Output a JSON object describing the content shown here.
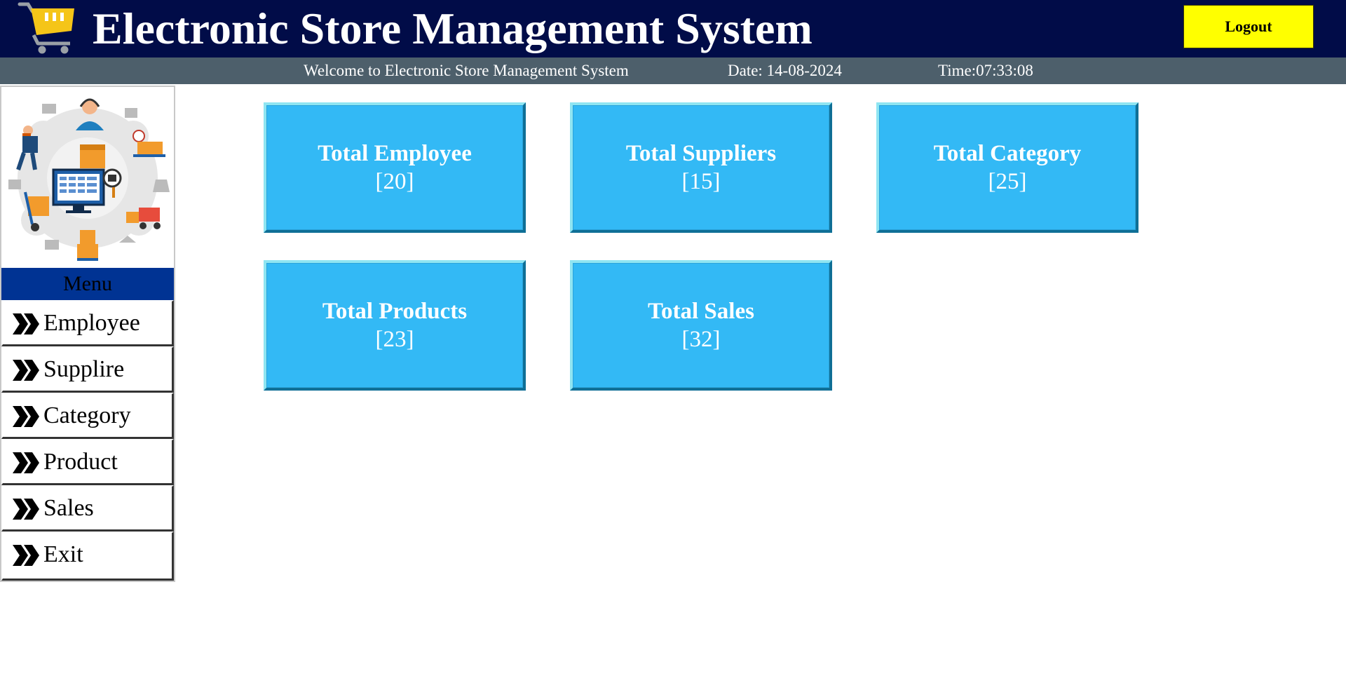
{
  "header": {
    "title": "Electronic Store Management System",
    "logout_label": "Logout",
    "logo_icon": "shopping-cart-icon"
  },
  "status_bar": {
    "welcome": "Welcome to Electronic Store Management System",
    "date": "Date: 14-08-2024",
    "time": "Time:07:33:08"
  },
  "sidebar": {
    "menu_title": "Menu",
    "items": [
      {
        "label": "Employee",
        "icon": "double-chevron-right-icon"
      },
      {
        "label": "Supplire",
        "icon": "double-chevron-right-icon"
      },
      {
        "label": "Category",
        "icon": "double-chevron-right-icon"
      },
      {
        "label": "Product",
        "icon": "double-chevron-right-icon"
      },
      {
        "label": "Sales",
        "icon": "double-chevron-right-icon"
      },
      {
        "label": "Exit",
        "icon": "double-chevron-right-icon"
      }
    ]
  },
  "dashboard": {
    "tiles": [
      {
        "title": "Total Employee",
        "count": "[20]"
      },
      {
        "title": "Total Suppliers",
        "count": "[15]"
      },
      {
        "title": "Total Category",
        "count": "[25]"
      },
      {
        "title": "Total Products",
        "count": "[23]"
      },
      {
        "title": "Total Sales",
        "count": "[32]"
      }
    ]
  },
  "colors": {
    "header_bg": "#010c48",
    "status_bg": "#4d5f6b",
    "logout_bg": "#ffff00",
    "menu_header_bg": "#003393",
    "tile_bg": "#33b9f5",
    "cart_accent": "#f5c518"
  }
}
